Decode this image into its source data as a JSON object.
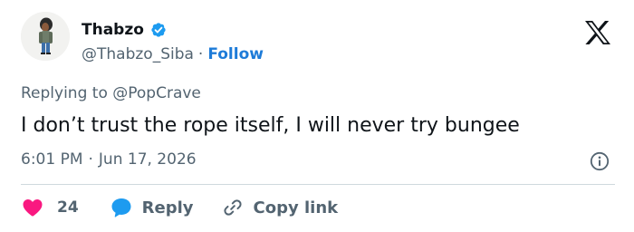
{
  "author": {
    "display_name": "Thabzo",
    "handle": "@Thabzo_Siba",
    "separator": "·",
    "follow_label": "Follow"
  },
  "reply_context": {
    "prefix": "Replying to",
    "mention": "@PopCrave"
  },
  "tweet": {
    "text": "I don’t trust the rope itself, I will never try bungee",
    "time": "6:01 PM",
    "separator": "·",
    "date": "Jun 17, 2026"
  },
  "actions": {
    "like_count": "24",
    "reply_label": "Reply",
    "copy_link_label": "Copy link"
  },
  "icons": {
    "verified": "verified-badge-icon",
    "platform": "x-logo-icon",
    "info": "info-icon",
    "like": "heart-icon",
    "reply": "speech-bubble-icon",
    "copy": "link-icon"
  },
  "colors": {
    "text_primary": "#0f1419",
    "text_secondary": "#536471",
    "accent_blue": "#1d7bd8",
    "like_red": "#f91880",
    "divider": "#cfd9de"
  }
}
